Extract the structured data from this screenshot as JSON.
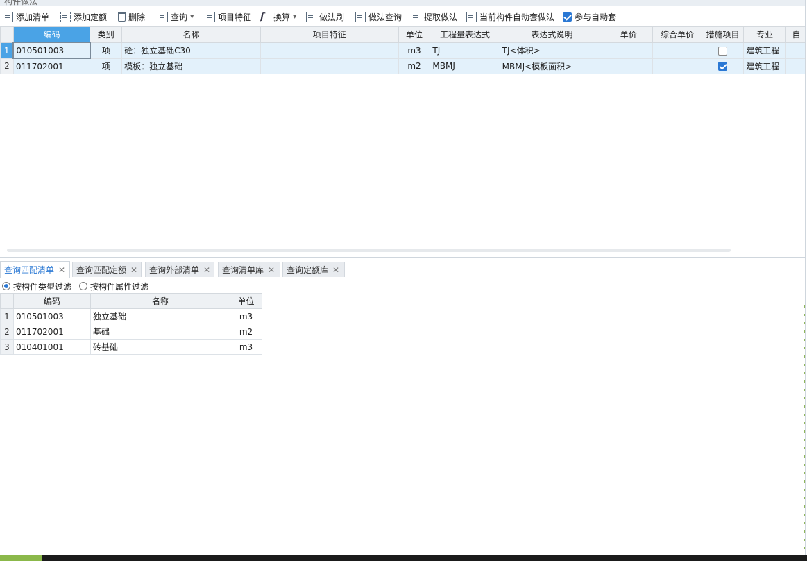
{
  "panel": {
    "title": "构件做法"
  },
  "toolbar": {
    "add_list": "添加清单",
    "add_quota": "添加定额",
    "delete": "删除",
    "query": "查询",
    "item_feature": "项目特征",
    "convert": "换算",
    "method_brush": "做法刷",
    "method_query": "做法查询",
    "extract_method": "提取做法",
    "current_auto_set": "当前构件自动套做法",
    "join_auto_set": "参与自动套",
    "join_auto_set_checked": true
  },
  "main_grid": {
    "columns": [
      "编码",
      "类别",
      "名称",
      "项目特征",
      "单位",
      "工程量表达式",
      "表达式说明",
      "单价",
      "综合单价",
      "措施项目",
      "专业",
      "自"
    ],
    "rows": [
      {
        "no": "1",
        "code": "010501003",
        "type": "项",
        "name": "砼：独立基础C30",
        "feature": "",
        "unit": "m3",
        "expr": "TJ",
        "expr_desc": "TJ<体积>",
        "price": "",
        "total_price": "",
        "measure": false,
        "major": "建筑工程"
      },
      {
        "no": "2",
        "code": "011702001",
        "type": "项",
        "name": "模板：独立基础",
        "feature": "",
        "unit": "m2",
        "expr": "MBMJ",
        "expr_desc": "MBMJ<模板面积>",
        "price": "",
        "total_price": "",
        "measure": true,
        "major": "建筑工程"
      }
    ]
  },
  "tabs": [
    "查询匹配清单",
    "查询匹配定额",
    "查询外部清单",
    "查询清单库",
    "查询定额库"
  ],
  "filters": {
    "by_type": "按构件类型过滤",
    "by_attr": "按构件属性过滤"
  },
  "match_grid": {
    "columns": [
      "编码",
      "名称",
      "单位"
    ],
    "rows": [
      {
        "no": "1",
        "code": "010501003",
        "name": "独立基础",
        "unit": "m3"
      },
      {
        "no": "2",
        "code": "011702001",
        "name": "基础",
        "unit": "m2"
      },
      {
        "no": "3",
        "code": "010401001",
        "name": "砖基础",
        "unit": "m3"
      }
    ]
  }
}
